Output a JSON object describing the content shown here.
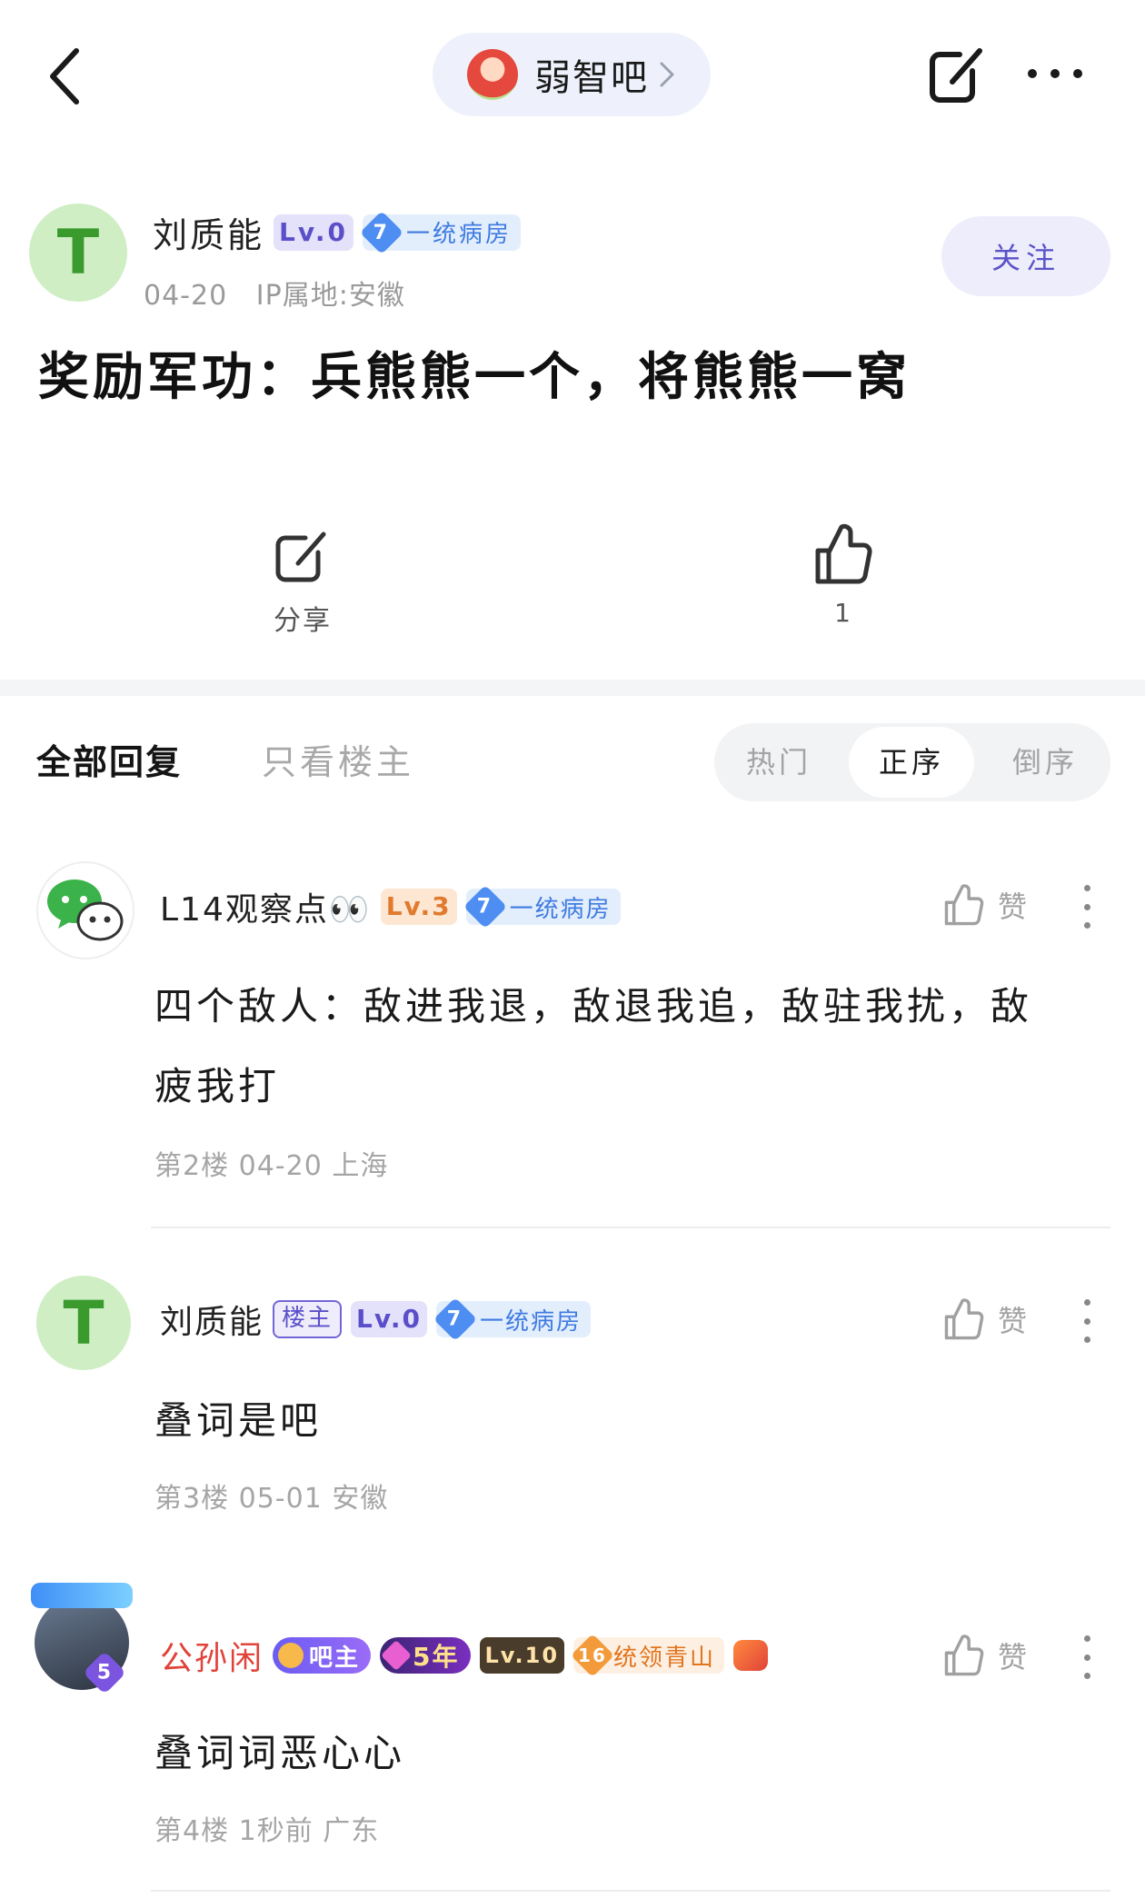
{
  "topbar": {
    "forum_name": "弱智吧"
  },
  "post": {
    "author": {
      "name": "刘质能",
      "level": "Lv.0",
      "tag_num": "7",
      "tag_title": "一统病房"
    },
    "date": "04-20",
    "ip": "IP属地:安徽",
    "follow_label": "关注",
    "title": "奖励军功：兵熊熊一个，将熊熊一窝",
    "share_label": "分享",
    "like_count": "1"
  },
  "reply_tabs": {
    "all": "全部回复",
    "owner_only": "只看楼主",
    "sort": [
      "热门",
      "正序",
      "倒序"
    ],
    "sort_active": "正序"
  },
  "replies": [
    {
      "name": "L14观察点👀",
      "level": "Lv.3",
      "tag_num": "7",
      "tag_title": "一统病房",
      "line1": "四个敌人：敌进我退，敌退我追，敌驻我扰，敌",
      "line2": "疲我打",
      "meta": "第2楼  04-20  上海",
      "like_label": "赞"
    },
    {
      "name": "刘质能",
      "owner_tag": "楼主",
      "level": "Lv.0",
      "tag_num": "7",
      "tag_title": "一统病房",
      "line1": "叠词是吧",
      "meta": "第3楼  05-01  安徽",
      "like_label": "赞"
    },
    {
      "name": "公孙闲",
      "admin_tag": "吧主",
      "years_tag": "5年",
      "level": "Lv.10",
      "honor_num": "16",
      "honor_title": "统领青山",
      "avatar_badge": "5",
      "line1": "叠词词恶心心",
      "meta": "第4楼  1秒前  广东",
      "like_label": "赞"
    }
  ],
  "colors": {
    "accent": "#5a52c8",
    "follow_bg": "#eeedfb",
    "tag_blue": "#4e8df2",
    "name_red": "#e0433a"
  }
}
